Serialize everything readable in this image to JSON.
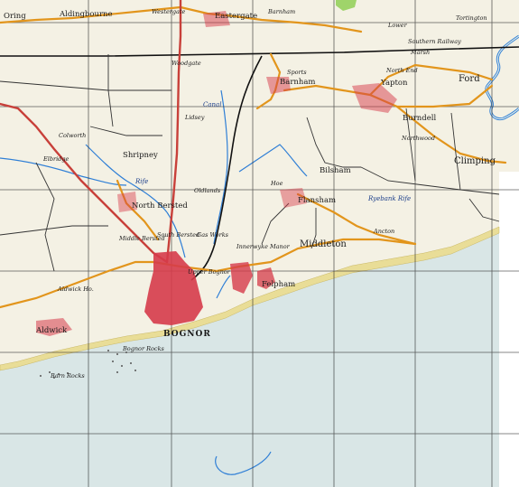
{
  "colors": {
    "land": "#f4f1e4",
    "sea": "#d9e6e6",
    "beach": "#e9dd97",
    "town": "#d63b4a",
    "road_main": "#c8403a",
    "road_secondary": "#e2951c",
    "river": "#2f7fd6",
    "rail": "#111111",
    "grid": "#2a2a2a",
    "woodland": "#9fd46a"
  },
  "places": {
    "oring": "Oring",
    "aldingbourne": "Aldingbourne",
    "westergate": "Westergate",
    "eastergate": "Eastergate",
    "barnham_top": "Barnham",
    "yapton": "Yapton",
    "ford": "Ford",
    "barnham": "Barnham",
    "burndell": "Burndell",
    "northwood": "Northwood",
    "woodgate": "Woodgate",
    "lidsey": "Lidsey",
    "colworth": "Colworth",
    "shripney": "Shripney",
    "elbridge": "Elbridge",
    "north_bersted": "North Bersted",
    "middle_bersted": "Middle Bersted",
    "south_bersted": "South Bersted",
    "upper_bognor": "Upper Bognor",
    "bognor": "BOGNOR",
    "bognor_rocks": "Bognor Rocks",
    "barn_rocks": "Barn Rocks",
    "aldwick": "Aldwick",
    "felpham": "Felpham",
    "middleton": "Middleton",
    "flansham": "Flansham",
    "bilsham": "Bilsham",
    "climping": "Climping",
    "innerwyke_manor": "Innerwyke Manor",
    "ancton": "Ancton",
    "gas_works": "Gas Works",
    "canal": "Canal",
    "rife": "Rife",
    "ryebank_rife": "Ryebank Rife",
    "southern_railway": "Southern Railway",
    "oldlands": "Oldlands",
    "sports": "Sports",
    "aldwick_ho": "Aldwick Ho.",
    "hoe": "Hoe",
    "tortington": "Tortington",
    "lower": "Lower",
    "marsh": "Marsh",
    "north_end": "North End"
  }
}
